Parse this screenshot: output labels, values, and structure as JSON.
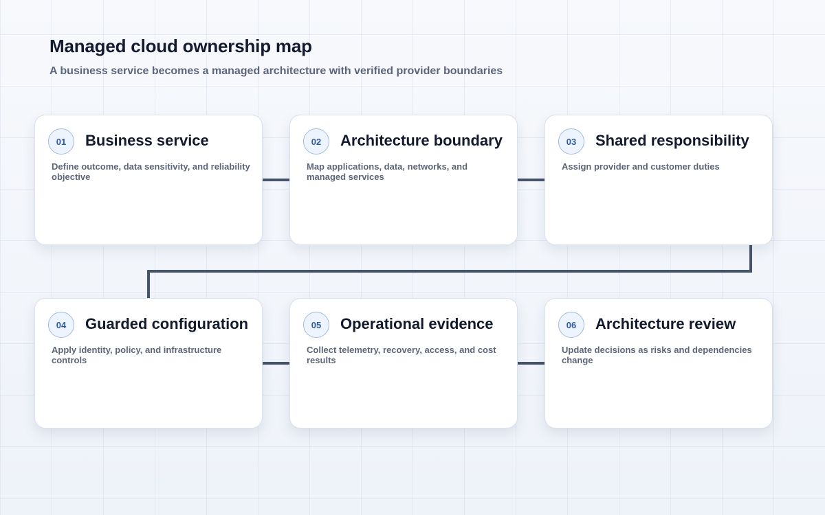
{
  "diagram": {
    "title": "Managed cloud ownership map",
    "subtitle": "A business service becomes a managed architecture with verified provider boundaries",
    "steps": [
      {
        "number": "01",
        "title": "Business service",
        "description": "Define outcome, data sensitivity, and reliability objective"
      },
      {
        "number": "02",
        "title": "Architecture boundary",
        "description": "Map applications, data, networks, and managed services"
      },
      {
        "number": "03",
        "title": "Shared responsibility",
        "description": "Assign provider and customer duties"
      },
      {
        "number": "04",
        "title": "Guarded configuration",
        "description": "Apply identity, policy, and infrastructure controls"
      },
      {
        "number": "05",
        "title": "Operational evidence",
        "description": "Collect telemetry, recovery, access, and cost results"
      },
      {
        "number": "06",
        "title": "Architecture review",
        "description": "Update decisions as risks and dependencies change"
      }
    ],
    "colors": {
      "connector": "#46546b",
      "badge_border": "#9fbbe6",
      "badge_fill": "#eef4fd",
      "badge_text": "#2d5cab",
      "title_text": "#111a2e",
      "muted_text": "#5b667a"
    }
  }
}
